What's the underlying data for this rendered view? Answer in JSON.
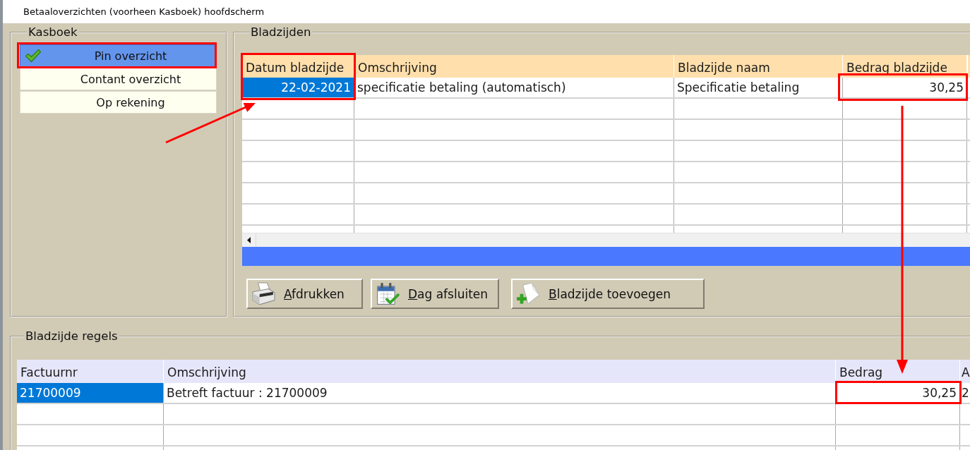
{
  "window": {
    "title": "Betaaloverzichten (voorheen Kasboek) hoofdscherm"
  },
  "kasboek": {
    "title": "Kasboek",
    "items": [
      {
        "label": "Pin overzicht",
        "selected": true
      },
      {
        "label": "Contant overzicht",
        "selected": false
      },
      {
        "label": "Op rekening",
        "selected": false
      }
    ]
  },
  "bladzijden": {
    "title": "Bladzijden",
    "table": {
      "columns": [
        {
          "label": "Datum bladzijde",
          "kind": "date"
        },
        {
          "label": "Omschrijving",
          "kind": "text"
        },
        {
          "label": "Bladzijde naam",
          "kind": "text"
        },
        {
          "label": "Bedrag bladzijde",
          "kind": "amount"
        }
      ],
      "rows": [
        {
          "cells": [
            {
              "text": "22-02-2021",
              "selected": true
            },
            {
              "text": "specificatie betaling (automatisch)",
              "selected": false
            },
            {
              "text": "Specificatie betaling",
              "selected": false
            },
            {
              "text": "30,25",
              "selected": false
            }
          ]
        }
      ]
    },
    "buttons": [
      {
        "label": "Afdrukken",
        "kind": "print"
      },
      {
        "label": "Dag afsluiten",
        "kind": "close"
      },
      {
        "label": "Bladzijde toevoegen",
        "kind": "add"
      }
    ]
  },
  "bladzijde_regels": {
    "title": "Bladzijde regels",
    "table": {
      "columns": [
        {
          "label": "Factuurnr",
          "kind": "text"
        },
        {
          "label": "Omschrijving",
          "kind": "text"
        },
        {
          "label": "Bedrag",
          "kind": "amount"
        },
        {
          "label": "A",
          "kind": "text"
        }
      ],
      "rows": [
        {
          "cells": [
            {
              "text": "21700009",
              "selected": true
            },
            {
              "text": "Betreft factuur : 21700009",
              "selected": false
            },
            {
              "text": "30,25",
              "selected": false
            },
            {
              "text": "2",
              "selected": false
            }
          ]
        }
      ]
    }
  }
}
